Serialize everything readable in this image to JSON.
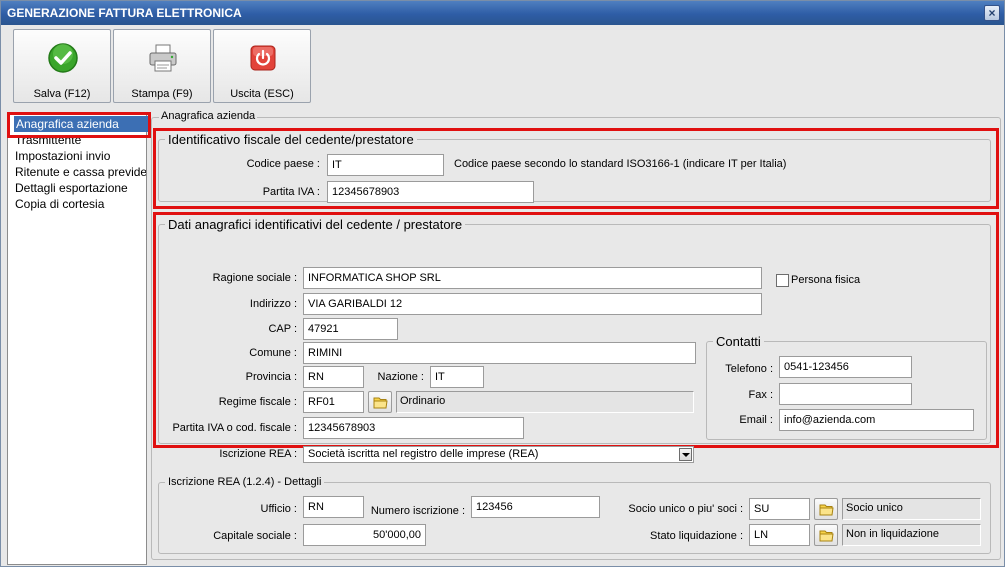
{
  "window": {
    "title": "GENERAZIONE FATTURA ELETTRONICA",
    "close_glyph": "×"
  },
  "toolbar": {
    "save_label": "Salva (F12)",
    "print_label": "Stampa (F9)",
    "exit_label": "Uscita (ESC)"
  },
  "nav": {
    "items": [
      {
        "label": "Anagrafica azienda",
        "selected": true
      },
      {
        "label": "Trasmittente"
      },
      {
        "label": "Impostazioni invio"
      },
      {
        "label": "Ritenute e cassa previdenziale"
      },
      {
        "label": "Dettagli esportazione"
      },
      {
        "label": "Copia di cortesia"
      }
    ]
  },
  "panel": {
    "title": "Anagrafica azienda"
  },
  "fiscal": {
    "legend": "Identificativo fiscale del cedente/prestatore",
    "country_label": "Codice paese :",
    "country_value": "IT",
    "country_hint": "Codice paese secondo lo standard ISO3166-1 (indicare IT per Italia)",
    "vat_label": "Partita IVA :",
    "vat_value": "12345678903"
  },
  "registry": {
    "legend": "Dati anagrafici identificativi del cedente / prestatore",
    "company_label": "Ragione sociale :",
    "company_value": "INFORMATICA SHOP SRL",
    "person_label": "Persona fisica",
    "person_checked": false,
    "address_label": "Indirizzo :",
    "address_value": "VIA GARIBALDI 12",
    "cap_label": "CAP :",
    "cap_value": "47921",
    "city_label": "Comune :",
    "city_value": "RIMINI",
    "province_label": "Provincia :",
    "province_value": "RN",
    "nation_label": "Nazione :",
    "nation_value": "IT",
    "regime_label": "Regime fiscale :",
    "regime_code": "RF01",
    "regime_desc": "Ordinario",
    "vatcf_label": "Partita IVA o cod. fiscale :",
    "vatcf_value": "12345678903"
  },
  "contacts": {
    "legend": "Contatti",
    "phone_label": "Telefono :",
    "phone_value": "0541-123456",
    "fax_label": "Fax :",
    "fax_value": "",
    "email_label": "Email :",
    "email_value": "info@azienda.com"
  },
  "rea": {
    "label": "Iscrizione REA :",
    "selected": "Società iscritta nel registro delle imprese (REA)"
  },
  "rea_details": {
    "legend": "Iscrizione REA (1.2.4) - Dettagli",
    "office_label": "Ufficio :",
    "office_value": "RN",
    "number_label": "Numero iscrizione :",
    "number_value": "123456",
    "partner_label": "Socio unico o piu' soci :",
    "partner_code": "SU",
    "partner_desc": "Socio unico",
    "capital_label": "Capitale sociale :",
    "capital_value": "50'000,00",
    "liquidation_label": "Stato liquidazione :",
    "liquidation_code": "LN",
    "liquidation_desc": "Non in liquidazione"
  },
  "colors": {
    "titlebar": "#2e5da6",
    "highlight": "#e01010",
    "selection": "#3c6fb4"
  }
}
